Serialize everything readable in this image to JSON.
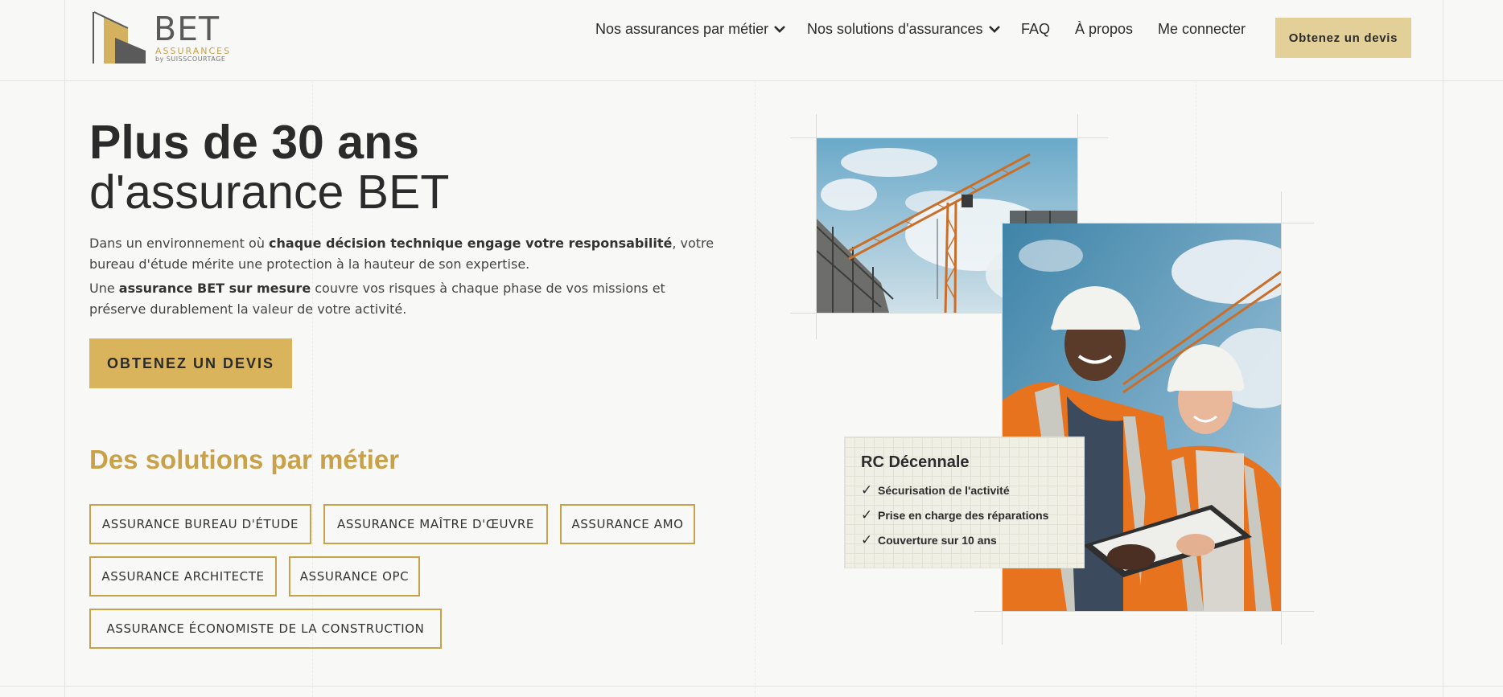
{
  "logo": {
    "word": "BET",
    "sub": "ASSURANCES",
    "by": "by SUISSCOURTAGE"
  },
  "nav": {
    "items": [
      {
        "label": "Nos assurances par métier",
        "has_dropdown": true
      },
      {
        "label": "Nos solutions d'assurances",
        "has_dropdown": true
      },
      {
        "label": "FAQ",
        "has_dropdown": false
      },
      {
        "label": "À propos",
        "has_dropdown": false
      },
      {
        "label": "Me connecter",
        "has_dropdown": false
      }
    ],
    "cta_label": "Obtenez un devis"
  },
  "hero": {
    "title_line1": "Plus de 30 ans",
    "title_line2": "d'assurance BET",
    "p1": {
      "a": "Dans un environnement où ",
      "b": "chaque décision technique engage votre responsabilité",
      "c": ", votre bureau d'étude mérite une protection à la hauteur de son expertise."
    },
    "p2": {
      "a": "Une ",
      "b": "assurance BET sur mesure",
      "c": " couvre vos risques à chaque phase de vos missions et préserve durablement la valeur de votre activité."
    },
    "cta_label": "OBTENEZ UN DEVIS"
  },
  "solutions": {
    "heading": "Des solutions par métier",
    "tags": [
      "ASSURANCE BUREAU D'ÉTUDE",
      "ASSURANCE MAÎTRE D'ŒUVRE",
      "ASSURANCE AMO",
      "ASSURANCE ARCHITECTE",
      "ASSURANCE OPC",
      "ASSURANCE ÉCONOMISTE DE LA CONSTRUCTION"
    ]
  },
  "card": {
    "title": "RC Décennale",
    "items": [
      "Sécurisation de l'activité",
      "Prise en charge des réparations",
      "Couverture sur 10 ans"
    ]
  },
  "colors": {
    "accent": "#d9b45c",
    "accent_text": "#c9a14a",
    "cta_top_bg": "#e3cf98",
    "background": "#f8f8f7",
    "text": "#2b2b2b"
  }
}
